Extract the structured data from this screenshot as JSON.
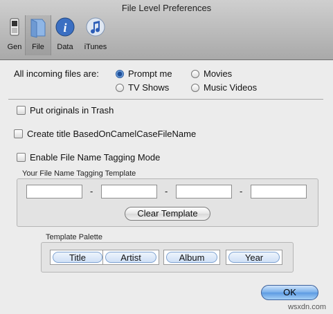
{
  "window": {
    "title": "File Level Preferences"
  },
  "toolbar": {
    "items": [
      {
        "label": "General",
        "label_visible": "Gen",
        "icon": "switch-icon"
      },
      {
        "label": "File",
        "icon": "folder-icon",
        "selected": true
      },
      {
        "label": "Data",
        "icon": "info-icon"
      },
      {
        "label": "iTunes",
        "icon": "itunes-icon"
      }
    ]
  },
  "incoming": {
    "label": "All incoming files are:",
    "options": [
      {
        "label": "Prompt me",
        "selected": true
      },
      {
        "label": "Movies",
        "selected": false
      },
      {
        "label": "TV Shows",
        "selected": false
      },
      {
        "label": "Music Videos",
        "selected": false
      }
    ]
  },
  "checkboxes": {
    "trash": {
      "label": "Put originals in Trash",
      "checked": false
    },
    "camel": {
      "label": "Create title BasedOnCamelCaseFileName",
      "checked": false
    },
    "tagging": {
      "label": "Enable File Name Tagging Mode",
      "checked": false
    }
  },
  "template": {
    "group_label": "Your File Name Tagging Template",
    "separator": "-",
    "fields": [
      "",
      "",
      "",
      ""
    ],
    "clear_label": "Clear Template"
  },
  "palette": {
    "group_label": "Template Palette",
    "items": [
      "Title",
      "Artist",
      "Album",
      "Year"
    ]
  },
  "ok_label": "OK",
  "watermark": "wsxdn.com",
  "colors": {
    "accent": "#5c9ae2",
    "chrome": "#a9a9a9"
  }
}
